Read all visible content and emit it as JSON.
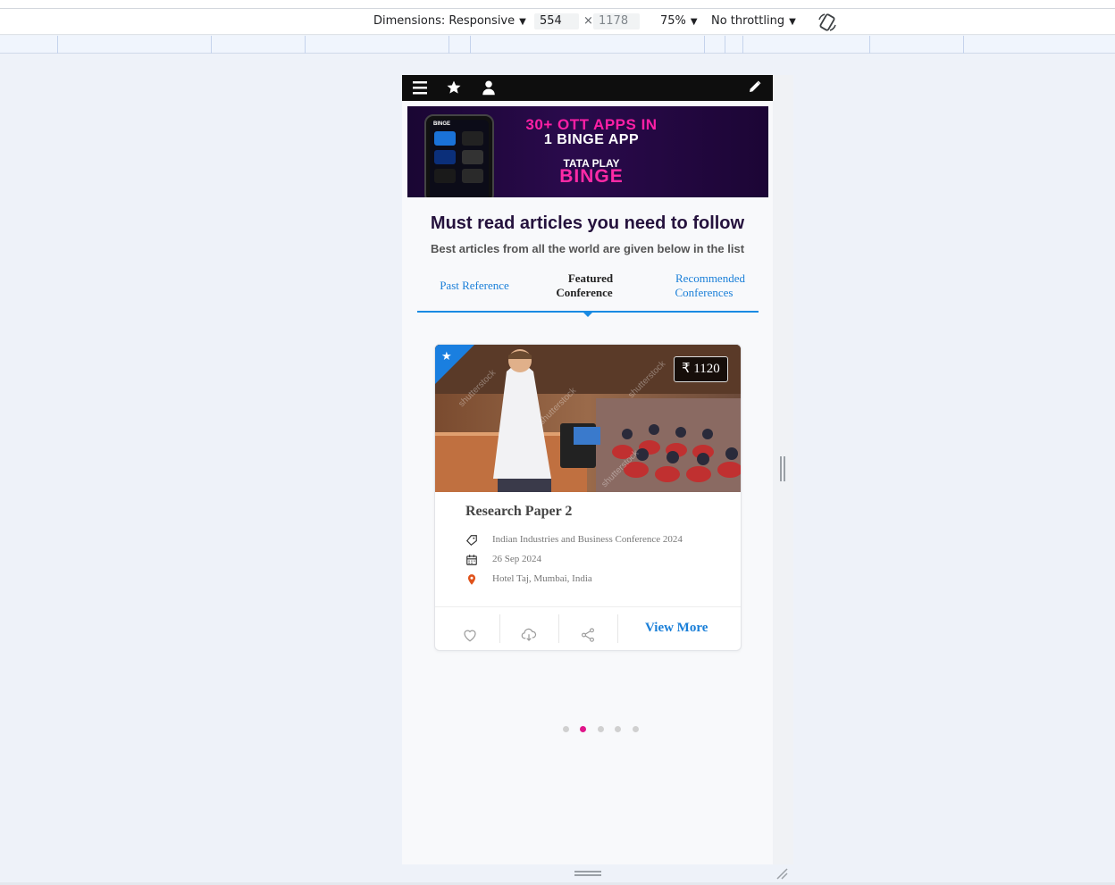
{
  "devtools": {
    "dimensions_label": "Dimensions: Responsive",
    "width_value": "554",
    "height_value": "1178",
    "times": "×",
    "zoom": "75%",
    "throttling": "No throttling"
  },
  "appbar": {
    "icons": [
      "menu-icon",
      "star-icon",
      "user-icon",
      "pencil-icon"
    ],
    "background": "#0e0e0e"
  },
  "banner": {
    "line1": "30+ OTT APPS IN",
    "line2": "1 BINGE APP",
    "line3": "TATA PLAY",
    "line4": "BINGE",
    "phone_brand": "BINGE",
    "accent": "#ff1fa5"
  },
  "section": {
    "title": "Must read articles you need to follow",
    "subtitle": "Best articles from all the world are given below in the list"
  },
  "tabs": [
    {
      "label": "Past Reference",
      "active": false
    },
    {
      "label": "Featured Conference",
      "active": true
    },
    {
      "label": "Recommended Conferences",
      "active": false
    }
  ],
  "card": {
    "price": "₹ 1120",
    "title": "Research Paper 2",
    "conference": "Indian Industries and Business Conference 2024",
    "date": "26 Sep 2024",
    "location": "Hotel Taj, Mumbai, India",
    "view_more": "View More",
    "ribbon_color": "#1a7fe0"
  },
  "pagination": {
    "count": 5,
    "active_index": 1,
    "active_color": "#e0168a"
  }
}
